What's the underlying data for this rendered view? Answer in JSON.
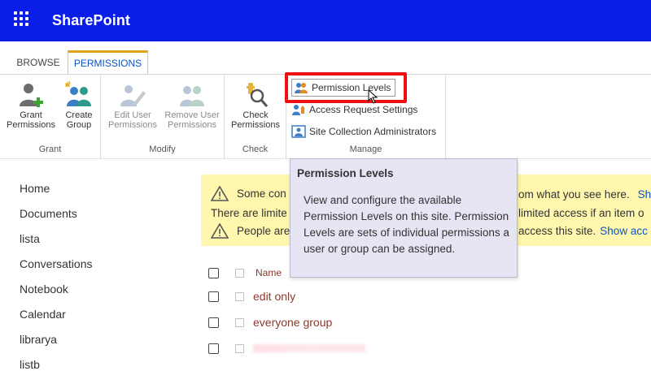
{
  "app": {
    "title": "SharePoint"
  },
  "tabs": [
    {
      "label": "BROWSE"
    },
    {
      "label": "PERMISSIONS"
    }
  ],
  "ribbon": {
    "groups": [
      {
        "label": "Grant",
        "buttons": [
          {
            "label1": "Grant",
            "label2": "Permissions"
          },
          {
            "label1": "Create",
            "label2": "Group"
          }
        ]
      },
      {
        "label": "Modify",
        "buttons": [
          {
            "label1": "Edit User",
            "label2": "Permissions"
          },
          {
            "label1": "Remove User",
            "label2": "Permissions"
          }
        ]
      },
      {
        "label": "Check",
        "buttons": [
          {
            "label1": "Check",
            "label2": "Permissions"
          }
        ]
      },
      {
        "label": "Manage",
        "items": [
          {
            "label": "Permission Levels"
          },
          {
            "label": "Access Request Settings"
          },
          {
            "label": "Site Collection Administrators"
          }
        ]
      }
    ]
  },
  "tooltip": {
    "title": "Permission Levels",
    "body": "View and configure the available Permission Levels on this site. Permission Levels are sets of individual permissions a user or group can be assigned."
  },
  "nav": [
    "Home",
    "Documents",
    "lista",
    "Conversations",
    "Notebook",
    "Calendar",
    "librarya",
    "listb"
  ],
  "warnings": {
    "row1_start": "Some con",
    "row1_end": "om what you see here.",
    "row1_link": "Sh",
    "row2_start": "There are limite",
    "row2_end": "limited access if an item o",
    "row3_start": "People are",
    "row3_end": "access this site.",
    "row3_link": "Show acc"
  },
  "list": {
    "header": "Name",
    "rows": [
      "edit only",
      "everyone group"
    ]
  },
  "colors": {
    "suite_bar": "#0b1ee8",
    "highlight_box": "#ee1111",
    "tab_accent": "#e3a21a",
    "warning_bg": "#fff7ae",
    "tooltip_bg": "#e5e5f3",
    "link_red": "#8b3a2e"
  }
}
